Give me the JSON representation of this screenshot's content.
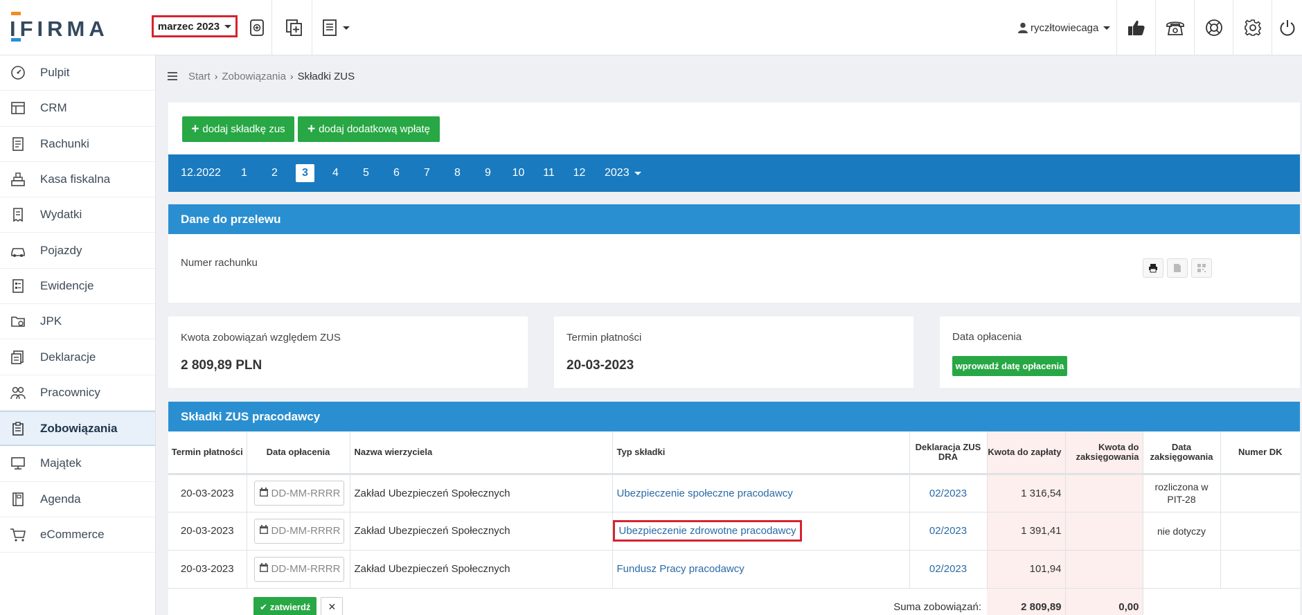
{
  "brand": {
    "logo_text": "IFIRMA",
    "accent_orange": "#f28c1f",
    "accent_blue": "#2a8fd6"
  },
  "header": {
    "month_select": "marzec 2023",
    "user_name": "ryczłtowiecaga",
    "icons": [
      "receipt-plus-icon",
      "copy-plus-icon",
      "document-list-icon",
      "thumbs-up-icon",
      "phone-icon",
      "lifebuoy-icon",
      "gear-icon",
      "power-icon"
    ]
  },
  "sidebar": {
    "items": [
      {
        "label": "Pulpit",
        "icon": "dashboard-icon"
      },
      {
        "label": "CRM",
        "icon": "crm-icon"
      },
      {
        "label": "Rachunki",
        "icon": "bill-icon"
      },
      {
        "label": "Kasa fiskalna",
        "icon": "cash-register-icon"
      },
      {
        "label": "Wydatki",
        "icon": "expenses-icon"
      },
      {
        "label": "Pojazdy",
        "icon": "car-icon"
      },
      {
        "label": "Ewidencje",
        "icon": "records-icon"
      },
      {
        "label": "JPK",
        "icon": "jpk-icon"
      },
      {
        "label": "Deklaracje",
        "icon": "declarations-icon"
      },
      {
        "label": "Pracownicy",
        "icon": "employees-icon"
      },
      {
        "label": "Zobowiązania",
        "icon": "clipboard-icon",
        "active": true
      },
      {
        "label": "Majątek",
        "icon": "monitor-icon"
      },
      {
        "label": "Agenda",
        "icon": "agenda-icon"
      },
      {
        "label": "eCommerce",
        "icon": "cart-icon"
      }
    ]
  },
  "breadcrumb": {
    "items": [
      "Start",
      "Zobowiązania"
    ],
    "current": "Składki ZUS"
  },
  "actions": {
    "add_zus": "dodaj składkę zus",
    "add_extra": "dodaj dodatkową wpłatę"
  },
  "months": {
    "items": [
      "12.2022",
      "1",
      "2",
      "3",
      "4",
      "5",
      "6",
      "7",
      "8",
      "9",
      "10",
      "11",
      "12"
    ],
    "active": "3",
    "year": "2023"
  },
  "transfer": {
    "title": "Dane do przelewu",
    "account_label": "Numer rachunku"
  },
  "summary": {
    "amount_label": "Kwota zobowiązań względem ZUS",
    "amount_value": "2 809,89 PLN",
    "due_label": "Termin płatności",
    "due_value": "20-03-2023",
    "paid_label": "Data opłacenia",
    "paid_button": "wprowadź datę opłacenia"
  },
  "table": {
    "title": "Składki ZUS pracodawcy",
    "headers": {
      "due": "Termin płatności",
      "paid": "Data opłacenia",
      "creditor": "Nazwa wierzyciela",
      "type": "Typ składki",
      "decl": "Deklaracja ZUS DRA",
      "to_pay": "Kwota do zapłaty",
      "to_book": "Kwota do zaksięgowania",
      "booked": "Data zaksięgowania",
      "dk": "Numer DK"
    },
    "date_placeholder": "DD-MM-RRRR",
    "rows": [
      {
        "due": "20-03-2023",
        "creditor": "Zakład Ubezpieczeń Społecznych",
        "type": "Ubezpieczenie społeczne pracodawcy",
        "decl": "02/2023",
        "to_pay": "1 316,54",
        "booked": "rozliczona w PIT-28"
      },
      {
        "due": "20-03-2023",
        "creditor": "Zakład Ubezpieczeń Społecznych",
        "type": "Ubezpieczenie zdrowotne pracodawcy",
        "decl": "02/2023",
        "to_pay": "1 391,41",
        "booked": "nie dotyczy"
      },
      {
        "due": "20-03-2023",
        "creditor": "Zakład Ubezpieczeń Społecznych",
        "type": "Fundusz Pracy pracodawcy",
        "decl": "02/2023",
        "to_pay": "101,94",
        "booked": ""
      }
    ],
    "confirm_label": "zatwierdź",
    "cancel_label": "✕",
    "sum_label": "Suma zobowiązań:",
    "sum_to_pay": "2 809,89",
    "sum_to_book": "0,00"
  }
}
